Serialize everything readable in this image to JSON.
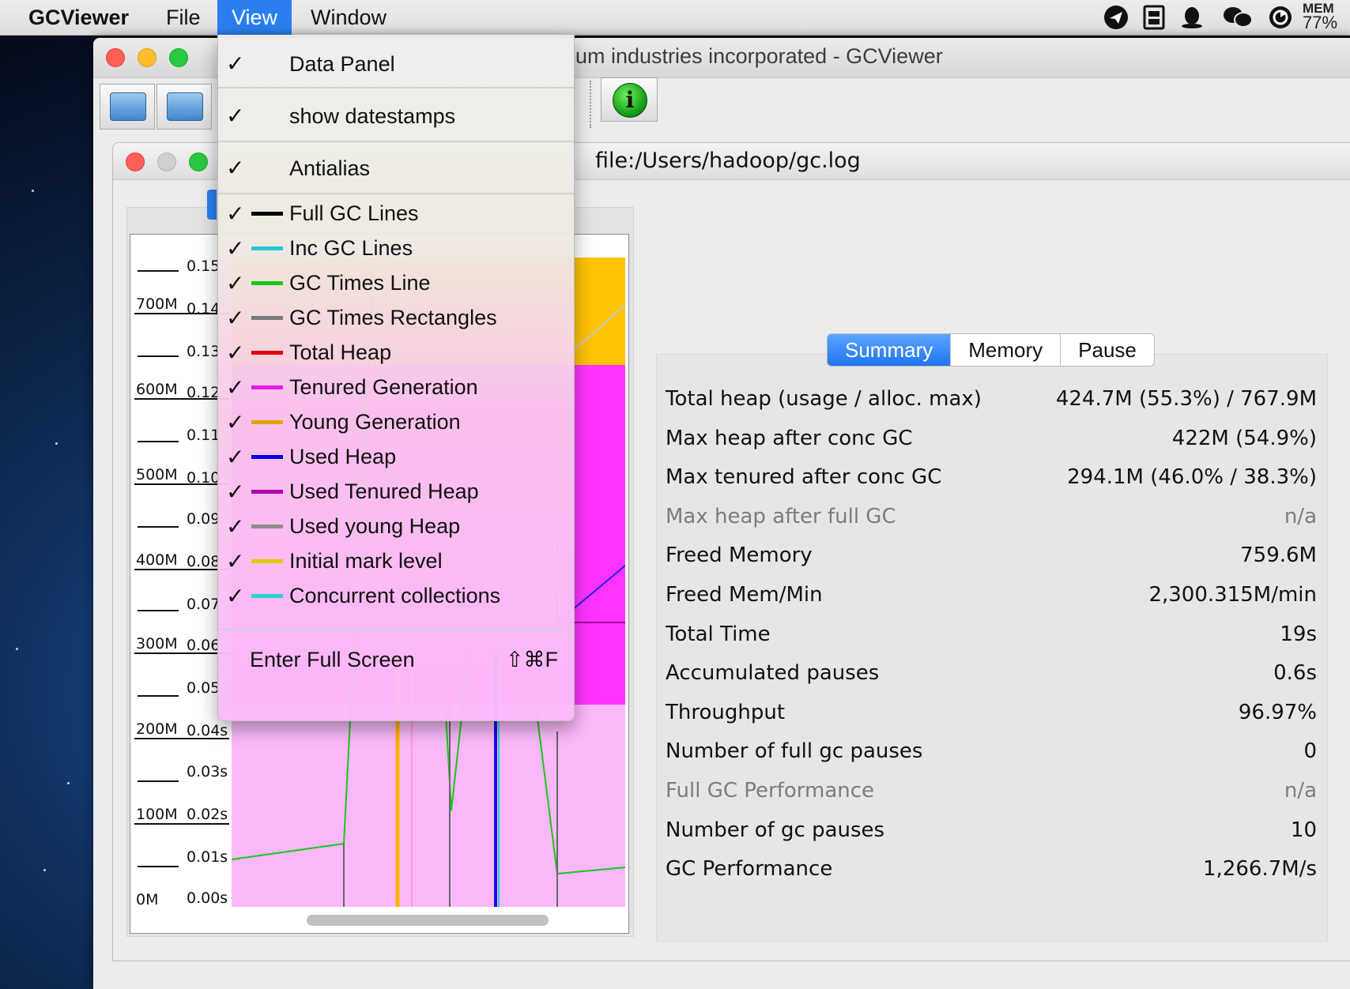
{
  "menubar": {
    "app_name": "GCViewer",
    "menus": [
      "File",
      "View",
      "Window"
    ],
    "mem_label": "MEM",
    "mem_value": "77%"
  },
  "main_window": {
    "title": "um industries incorporated - GCViewer"
  },
  "document_window": {
    "title": "file:/Users/hadoop/gc.log"
  },
  "view_menu": {
    "top_items": [
      {
        "label": "Data Panel",
        "checked": true
      },
      {
        "label": "show datestamps",
        "checked": true
      },
      {
        "label": "Antialias",
        "checked": true
      }
    ],
    "line_items": [
      {
        "label": "Full GC Lines",
        "color": "#000000"
      },
      {
        "label": "Inc GC Lines",
        "color": "#21c8d6"
      },
      {
        "label": "GC Times Line",
        "color": "#16c816"
      },
      {
        "label": "GC Times Rectangles",
        "color": "#7a7a7a"
      },
      {
        "label": "Total Heap",
        "color": "#e00000"
      },
      {
        "label": "Tenured Generation",
        "color": "#e21ee2"
      },
      {
        "label": "Young Generation",
        "color": "#e3a200"
      },
      {
        "label": "Used Heap",
        "color": "#0000e0"
      },
      {
        "label": "Used Tenured Heap",
        "color": "#b000b0"
      },
      {
        "label": "Used young Heap",
        "color": "#8c8c8c"
      },
      {
        "label": "Initial mark level",
        "color": "#d8cc00"
      },
      {
        "label": "Concurrent collections",
        "color": "#2ad0d0"
      }
    ],
    "check_glyph": "✓",
    "fullscreen_label": "Enter Full Screen",
    "fullscreen_shortcut": "⇧⌘F"
  },
  "chart": {
    "heap_labels": [
      "700M",
      "600M",
      "500M",
      "400M",
      "300M",
      "200M",
      "100M",
      "0M"
    ],
    "time_labels": [
      "0.15",
      "0.14",
      "0.13",
      "0.12",
      "0.11",
      "0.10",
      "0.09",
      "0.08",
      "0.07",
      "0.06",
      "0.05",
      "0.04s",
      "0.03s",
      "0.02s",
      "0.01s",
      "0.00s"
    ]
  },
  "data_panel": {
    "tabs": [
      "Summary",
      "Memory",
      "Pause"
    ],
    "selected_tab": "Summary",
    "rows": [
      {
        "label": "Total heap (usage / alloc. max)",
        "value": "424.7M (55.3%) / 767.9M",
        "dim": false
      },
      {
        "label": "Max heap after conc GC",
        "value": "422M (54.9%)",
        "dim": false
      },
      {
        "label": "Max tenured after conc GC",
        "value": "294.1M (46.0% / 38.3%)",
        "dim": false
      },
      {
        "label": "Max heap after full GC",
        "value": "n/a",
        "dim": true
      },
      {
        "label": "Freed Memory",
        "value": "759.6M",
        "dim": false
      },
      {
        "label": "Freed Mem/Min",
        "value": "2,300.315M/min",
        "dim": false
      },
      {
        "label": "Total Time",
        "value": "19s",
        "dim": false
      },
      {
        "label": "Accumulated pauses",
        "value": "0.6s",
        "dim": false
      },
      {
        "label": "Throughput",
        "value": "96.97%",
        "dim": false
      },
      {
        "label": "Number of full gc pauses",
        "value": "0",
        "dim": false
      },
      {
        "label": "Full GC Performance",
        "value": "n/a",
        "dim": true
      },
      {
        "label": "Number of gc pauses",
        "value": "10",
        "dim": false
      },
      {
        "label": "GC Performance",
        "value": "1,266.7M/s",
        "dim": false
      }
    ]
  },
  "tray_icons": [
    "send-icon",
    "film-icon",
    "qq-penguin-icon",
    "wechat-icon",
    "sync-icon"
  ]
}
